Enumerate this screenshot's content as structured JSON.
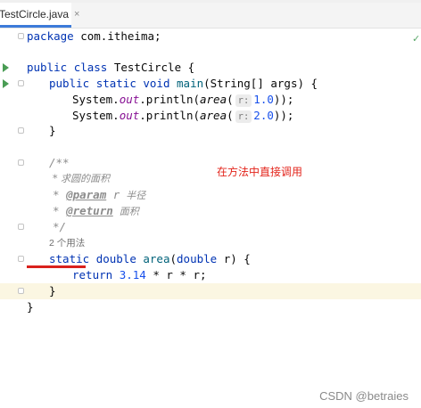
{
  "tab": {
    "filename": "TestCircle.java",
    "close_glyph": "×",
    "accent": "#3d7bd9"
  },
  "code": {
    "l1": {
      "kw": "package",
      "rest": " com.itheima;"
    },
    "l3": {
      "kw1": "public",
      "kw2": "class",
      "rest": " TestCircle {"
    },
    "l4": {
      "kw1": "public",
      "kw2": "static",
      "kw3": "void",
      "name": "main",
      "rest": "(String[] args) {"
    },
    "l5": {
      "pre": "System.",
      "field": "out",
      "mid": ".println(",
      "call": "area",
      "open": "(",
      "hint": "r:",
      "num": "1.0",
      "close": "));"
    },
    "l6": {
      "pre": "System.",
      "field": "out",
      "mid": ".println(",
      "call": "area",
      "open": "(",
      "hint": "r:",
      "num": "2.0",
      "close": "));"
    },
    "l7": "}",
    "l9": "/**",
    "l10": "* 求圆的面积",
    "l11": {
      "star": "* ",
      "tag": "@param",
      "param": " r",
      "desc": "  半径"
    },
    "l12": {
      "star": "* ",
      "tag": "@return",
      "desc": "  面积"
    },
    "l13": "*/",
    "usages": "2 个用法",
    "l14": {
      "kw1": "static",
      "kw2": "double",
      "name": "area",
      "open": "(",
      "kw3": "double",
      "rest": " r) {"
    },
    "l15": {
      "kw": "return",
      "num": "3.14",
      "rest": " * r * r;"
    },
    "l16": "}",
    "l17": "}"
  },
  "annotation": {
    "text": "在方法中直接调用",
    "color": "#e3241b"
  },
  "watermark": "CSDN @betraies",
  "icons": {
    "run": "run-gutter-icon",
    "fold": "fold-marker-icon",
    "check": "inspection-ok-icon"
  }
}
